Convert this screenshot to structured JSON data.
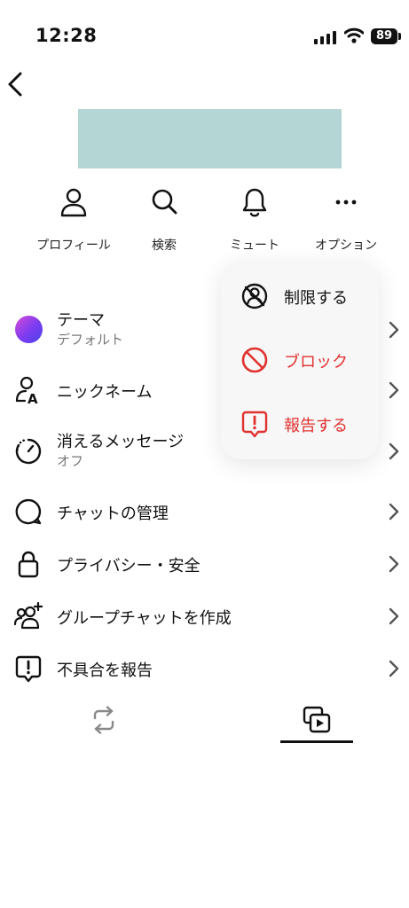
{
  "status_bar": {
    "time": "12:28",
    "battery": "89"
  },
  "actions": [
    {
      "label": "プロフィール",
      "icon": "person-icon"
    },
    {
      "label": "検索",
      "icon": "search-icon"
    },
    {
      "label": "ミュート",
      "icon": "bell-icon"
    },
    {
      "label": "オプション",
      "icon": "more-icon"
    }
  ],
  "settings": [
    {
      "title": "テーマ",
      "subtitle": "デフォルト",
      "icon": "theme-gradient-icon"
    },
    {
      "title": "ニックネーム",
      "icon": "person-a-icon"
    },
    {
      "title": "消えるメッセージ",
      "subtitle": "オフ",
      "icon": "timer-icon"
    },
    {
      "title": "チャットの管理",
      "icon": "chat-bubble-icon"
    },
    {
      "title": "プライバシー・安全",
      "icon": "lock-icon"
    },
    {
      "title": "グループチャットを作成",
      "icon": "add-people-icon"
    },
    {
      "title": "不具合を報告",
      "icon": "report-icon"
    }
  ],
  "options_menu": [
    {
      "label": "制限する",
      "icon": "restrict-icon",
      "color": "#111111"
    },
    {
      "label": "ブロック",
      "icon": "block-icon",
      "color": "#e0312f"
    },
    {
      "label": "報告する",
      "icon": "report-icon",
      "color": "#e0312f"
    }
  ],
  "tabs": [
    {
      "icon": "repost-icon",
      "selected": false
    },
    {
      "icon": "media-icon",
      "selected": true
    }
  ]
}
